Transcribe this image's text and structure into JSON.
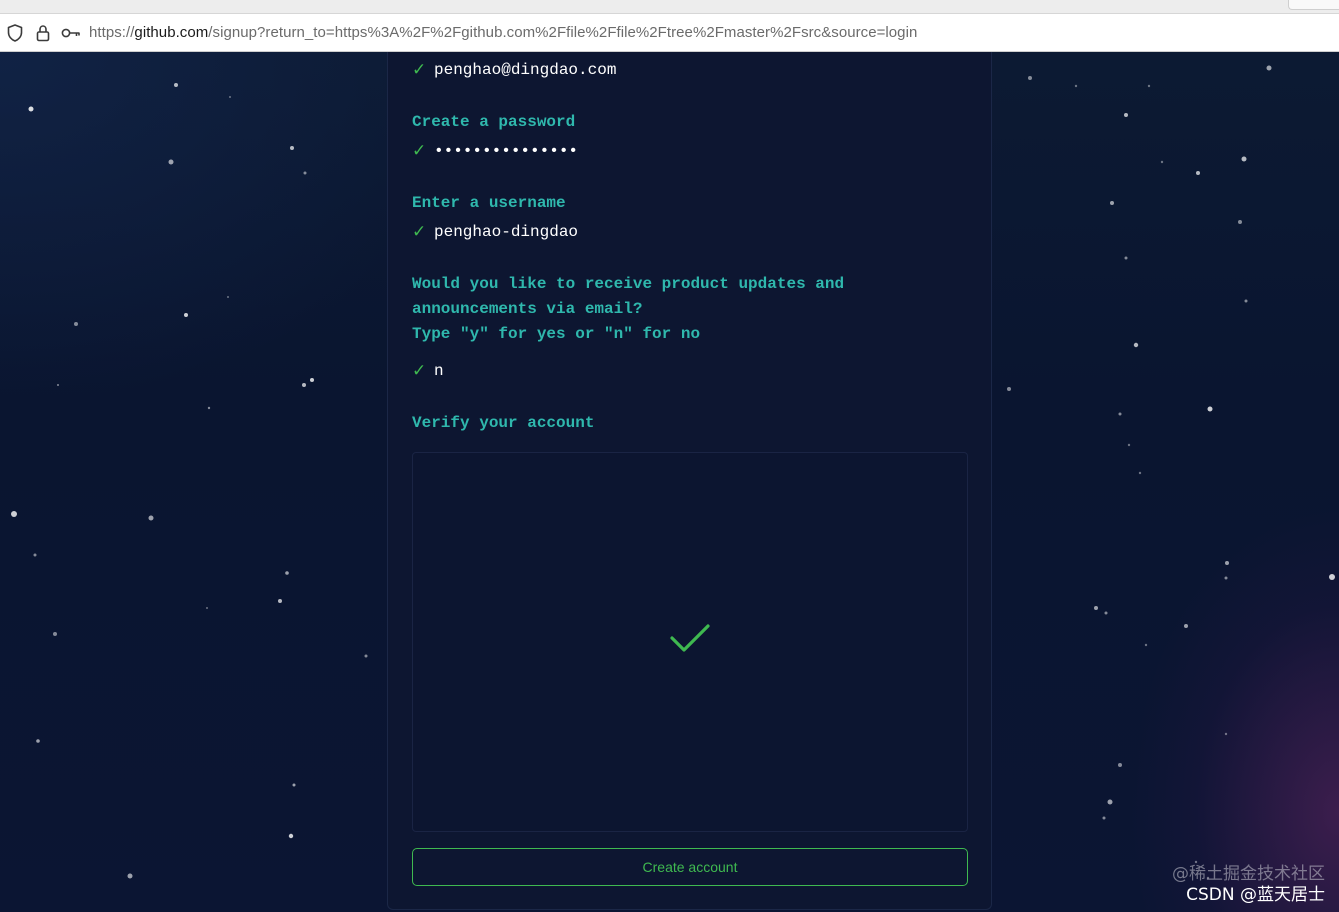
{
  "browser": {
    "url_prefix": "https://",
    "url_host": "github.com",
    "url_path": "/signup?return_to=https%3A%2F%2Fgithub.com%2Ffile%2Ffile%2Ftree%2Fmaster%2Fsrc&source=login",
    "icons": [
      "shield-icon",
      "lock-icon",
      "key-icon"
    ]
  },
  "signup": {
    "email_value": "penghao@dingdao.com",
    "password_prompt": "Create a password",
    "password_value": "•••••••••••••••",
    "username_prompt": "Enter a username",
    "username_value": "penghao-dingdao",
    "updates_prompt_line1": "Would you like to receive product updates and",
    "updates_prompt_line2": "announcements via email?",
    "updates_prompt_line3": "Type \"y\" for yes or \"n\" for no",
    "updates_value": "n",
    "verify_prompt": "Verify your account",
    "check_glyph": "✓",
    "create_button_label": "Create account"
  },
  "watermark": {
    "line1": "@稀土掘金技术社区",
    "line2": "CSDN @蓝天居士"
  },
  "colors": {
    "background": "#0b1630",
    "card": "#0d1631",
    "prompt_teal": "#2fb8ad",
    "success_green": "#3fb950"
  }
}
